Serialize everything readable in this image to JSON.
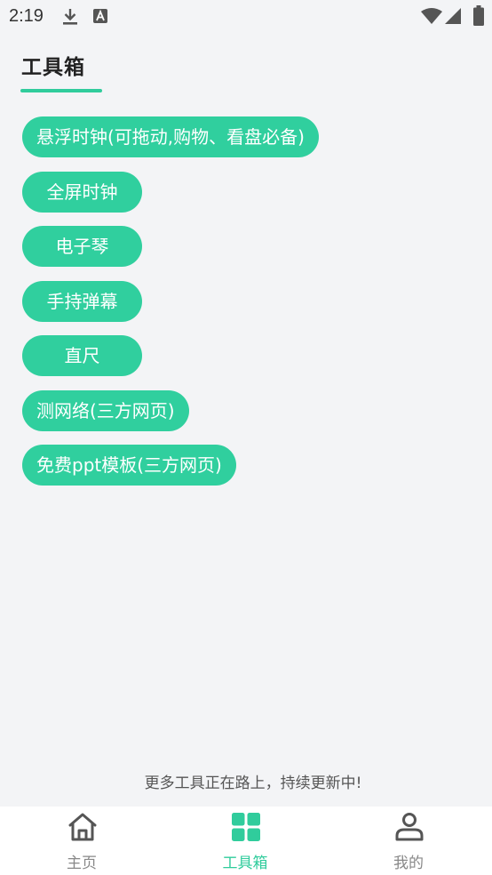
{
  "status_bar": {
    "time": "2:19",
    "icons": [
      "download-icon",
      "a-icon",
      "wifi-icon",
      "signal-icon",
      "battery-icon"
    ]
  },
  "header": {
    "title": "工具箱"
  },
  "tools": [
    "悬浮时钟(可拖动,购物、看盘必备)",
    "全屏时钟",
    "电子琴",
    "手持弹幕",
    "直尺",
    "测网络(三方网页)",
    "免费ppt模板(三方网页)"
  ],
  "footer_note": "更多工具正在路上，持续更新中!",
  "bottom_nav": {
    "home_label": "主页",
    "tools_label": "工具箱",
    "mine_label": "我的",
    "active": "工具箱"
  },
  "colors": {
    "accent": "#30cc9c",
    "background": "#f3f4f6",
    "nav_inactive": "#888888"
  }
}
